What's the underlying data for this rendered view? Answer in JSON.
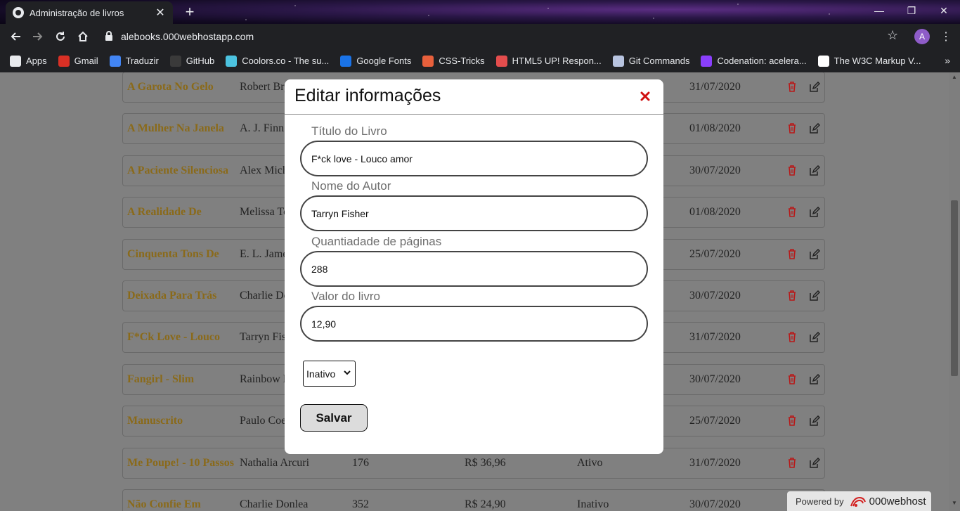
{
  "browser": {
    "tab_title": "Administração de livros",
    "tab_close": "✕",
    "new_tab": "+",
    "url": "alebooks.000webhostapp.com",
    "avatar_letter": "A",
    "bookmarks": [
      {
        "label": "Apps",
        "icon": "apps-grid-icon",
        "color": "#e8eaed"
      },
      {
        "label": "Gmail",
        "icon": "gmail-icon",
        "color": "#d93025"
      },
      {
        "label": "Traduzir",
        "icon": "translate-icon",
        "color": "#4285f4"
      },
      {
        "label": "GitHub",
        "icon": "github-icon",
        "color": "#3a3a3a"
      },
      {
        "label": "Coolors.co - The su...",
        "icon": "coolors-icon",
        "color": "#4cc3e0"
      },
      {
        "label": "Google Fonts",
        "icon": "google-fonts-icon",
        "color": "#1a73e8"
      },
      {
        "label": "CSS-Tricks",
        "icon": "css-tricks-icon",
        "color": "#e8603c"
      },
      {
        "label": "HTML5 UP! Respon...",
        "icon": "html5up-icon",
        "color": "#e44d4d"
      },
      {
        "label": "Git Commands",
        "icon": "git-icon",
        "color": "#b8c4e0"
      },
      {
        "label": "Codenation: acelera...",
        "icon": "codenation-icon",
        "color": "#8a3ffc"
      },
      {
        "label": "The W3C Markup V...",
        "icon": "w3c-icon",
        "color": "#ffffff"
      }
    ],
    "bookmarks_overflow": "»"
  },
  "books": [
    {
      "title": "A Garota No Gelo",
      "author": "Robert Bryndza",
      "pages": "",
      "price": "",
      "status": "",
      "date": "31/07/2020"
    },
    {
      "title": "A Mulher Na Janela",
      "author": "A. J. Finn",
      "pages": "",
      "price": "",
      "status": "",
      "date": "01/08/2020"
    },
    {
      "title": "A Paciente Silenciosa",
      "author": "Alex Michaelides",
      "pages": "",
      "price": "",
      "status": "",
      "date": "30/07/2020"
    },
    {
      "title": "A Realidade De",
      "author": "Melissa Toppen",
      "pages": "",
      "price": "",
      "status": "",
      "date": "01/08/2020"
    },
    {
      "title": "Cinquenta Tons De",
      "author": "E. L. James",
      "pages": "",
      "price": "",
      "status": "",
      "date": "25/07/2020"
    },
    {
      "title": "Deixada Para Trás",
      "author": "Charlie Donlea",
      "pages": "",
      "price": "",
      "status": "",
      "date": "30/07/2020"
    },
    {
      "title": "F*Ck Love - Louco",
      "author": "Tarryn Fisher",
      "pages": "",
      "price": "",
      "status": "",
      "date": "31/07/2020"
    },
    {
      "title": "Fangirl - Slim",
      "author": "Rainbow Rowell",
      "pages": "",
      "price": "",
      "status": "",
      "date": "30/07/2020"
    },
    {
      "title": "Manuscrito",
      "author": "Paulo Coelho",
      "pages": "",
      "price": "",
      "status": "",
      "date": "25/07/2020"
    },
    {
      "title": "Me Poupe! - 10 Passos",
      "author": "Nathalia Arcuri",
      "pages": "176",
      "price": "R$ 36,96",
      "status": "Ativo",
      "date": "31/07/2020"
    },
    {
      "title": "Não Confie Em",
      "author": "Charlie Donlea",
      "pages": "352",
      "price": "R$ 24,90",
      "status": "Inativo",
      "date": "30/07/2020"
    }
  ],
  "modal": {
    "title": "Editar informações",
    "fields": {
      "title_label": "Título do Livro",
      "title_value": "F*ck love - Louco amor",
      "author_label": "Nome do Autor",
      "author_value": "Tarryn Fisher",
      "pages_label": "Quantiadade de páginas",
      "pages_value": "288",
      "price_label": "Valor do livro",
      "price_value": "12,90"
    },
    "status_selected": "Inativo",
    "save_label": "Salvar"
  },
  "footer": {
    "powered_by": "Powered by",
    "brand": "000webhost"
  },
  "colors": {
    "close_red": "#d01010",
    "delete_red": "#b81818",
    "title_gold": "#8a6a1a"
  }
}
